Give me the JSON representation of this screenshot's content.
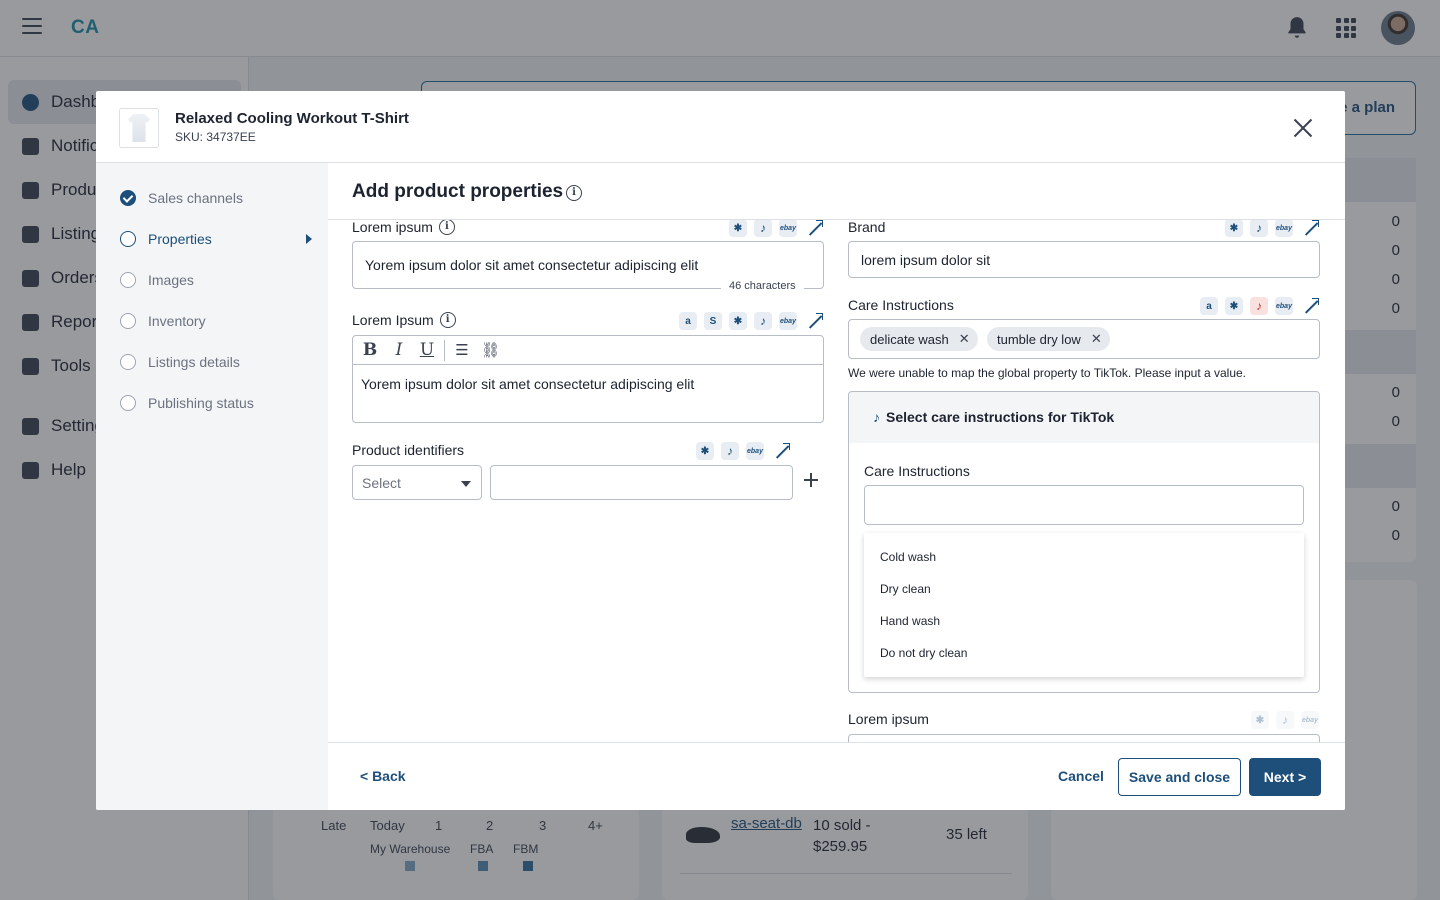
{
  "app": {
    "logo": "CA",
    "nav": [
      {
        "label": "Dashboard",
        "icon": "dashboard-icon"
      },
      {
        "label": "Notifications",
        "icon": "bell-icon"
      },
      {
        "label": "Products",
        "icon": "box-icon"
      },
      {
        "label": "Listings",
        "icon": "tag-icon"
      },
      {
        "label": "Orders",
        "icon": "cart-icon"
      },
      {
        "label": "Reports",
        "icon": "report-icon"
      },
      {
        "label": "Tools",
        "icon": "tools-icon"
      },
      {
        "label": "Settings",
        "icon": "gear-icon"
      },
      {
        "label": "Help",
        "icon": "help-icon"
      }
    ],
    "banner_button": "e a plan",
    "stats_values": [
      "0",
      "0",
      "0",
      "0",
      "0",
      "0",
      "0",
      "0"
    ],
    "chart_ticks": [
      "Late",
      "Today",
      "1",
      "2",
      "3",
      "4+"
    ],
    "chart_legend": [
      "My Warehouse",
      "FBA",
      "FBM"
    ],
    "sale": {
      "sku": "sa-seat-db",
      "sold": "10 sold - $259.95",
      "left": "35 left"
    }
  },
  "modal": {
    "product_title": "Relaxed Cooling Workout T-Shirt",
    "product_sku": "SKU: 34737EE",
    "steps": [
      {
        "label": "Sales channels",
        "state": "done"
      },
      {
        "label": "Properties",
        "state": "current"
      },
      {
        "label": "Images",
        "state": "todo"
      },
      {
        "label": "Inventory",
        "state": "todo"
      },
      {
        "label": "Listings details",
        "state": "todo"
      },
      {
        "label": "Publishing status",
        "state": "todo"
      }
    ],
    "title": "Add product properties",
    "fields": {
      "title_field": {
        "label": "Lorem ipsum",
        "value": "Yorem ipsum dolor sit amet consectetur adipiscing elit",
        "char_count": "46 characters"
      },
      "description_field": {
        "label": "Lorem Ipsum",
        "value": "Yorem ipsum dolor sit amet consectetur adipiscing elit"
      },
      "identifiers": {
        "label": "Product identifiers",
        "select_placeholder": "Select",
        "value": ""
      },
      "brand": {
        "label": "Brand",
        "value": "lorem ipsum dolor sit"
      },
      "care": {
        "label": "Care Instructions",
        "chips": [
          "delicate wash",
          "tumble dry low"
        ],
        "warning": "We were unable to map the global property to TikTok. Please input a value.",
        "tiktok_panel_title": "Select care instructions for TikTok",
        "tiktok_field_label": "Care Instructions",
        "tiktok_value": "",
        "options": [
          "Cold wash",
          "Dry clean",
          "Hand wash",
          "Do not dry clean"
        ]
      },
      "extra": {
        "label": "Lorem ipsum"
      }
    },
    "channel_glyphs": {
      "walmart": "✱",
      "tiktok": "♪",
      "ebay": "ebay",
      "amazon": "a",
      "shopify": "S"
    },
    "footer": {
      "back": "< Back",
      "cancel": "Cancel",
      "save": "Save and close",
      "next": "Next >"
    }
  }
}
